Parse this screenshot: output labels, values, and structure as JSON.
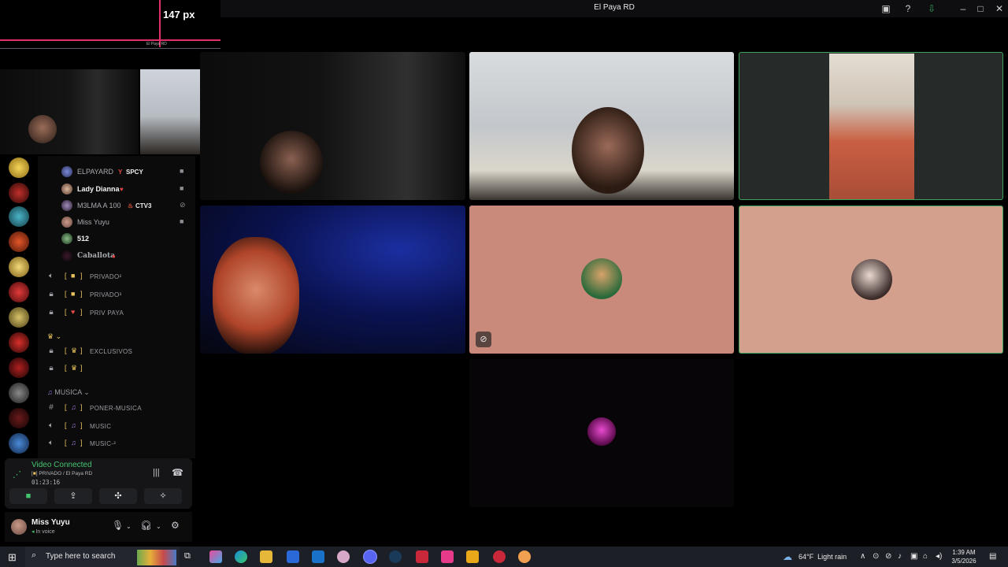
{
  "window": {
    "title": "El Paya RD"
  },
  "overlay": {
    "measure_label": "147 px",
    "mini_caption": "El Paya RD"
  },
  "members": [
    {
      "name": "ELPAYARD",
      "tag": "SPCY",
      "icon": "camera-icon"
    },
    {
      "name": "Lady Dianna",
      "tag": "",
      "icon": "camera-icon"
    },
    {
      "name": "M3LMA A 100",
      "tag": "CTV3",
      "icon": "mic-off-icon"
    },
    {
      "name": "Miss Yuyu",
      "tag": "",
      "icon": "camera-icon"
    },
    {
      "name": "512",
      "tag": "",
      "icon": ""
    },
    {
      "name": "Caballota",
      "tag": "",
      "icon": ""
    }
  ],
  "channels": [
    {
      "icon": "speaker-icon",
      "label": "PRIVADO²"
    },
    {
      "icon": "lock-icon",
      "label": "PRIVADO³"
    },
    {
      "icon": "lock-icon",
      "label": "PRIV PAYA"
    },
    {
      "icon": "lock-icon",
      "label": "EXCLUSIVOS"
    },
    {
      "icon": "lock-icon",
      "label": ""
    }
  ],
  "category": {
    "label": "MUSICA"
  },
  "music_channels": [
    {
      "icon": "hash-icon",
      "label": "PONER-MUSICA"
    },
    {
      "icon": "speaker-icon",
      "label": "MUSIC"
    },
    {
      "icon": "speaker-icon",
      "label": "MUSIC-²"
    }
  ],
  "voice": {
    "status": "Video Connected",
    "channel": "PRIVADO / El Paya RD",
    "elapsed": "01:23:16"
  },
  "user": {
    "name": "Miss Yuyu",
    "status": "In voice"
  },
  "taskbar": {
    "search_placeholder": "Type here to search",
    "temperature": "64°F",
    "weather": "Light rain",
    "time": "1:39 AM",
    "date": "3/5/2026"
  },
  "colors": {
    "connected": "#45c46f",
    "speaking_border": "#3ba55c",
    "measure_line": "#e0306a"
  }
}
